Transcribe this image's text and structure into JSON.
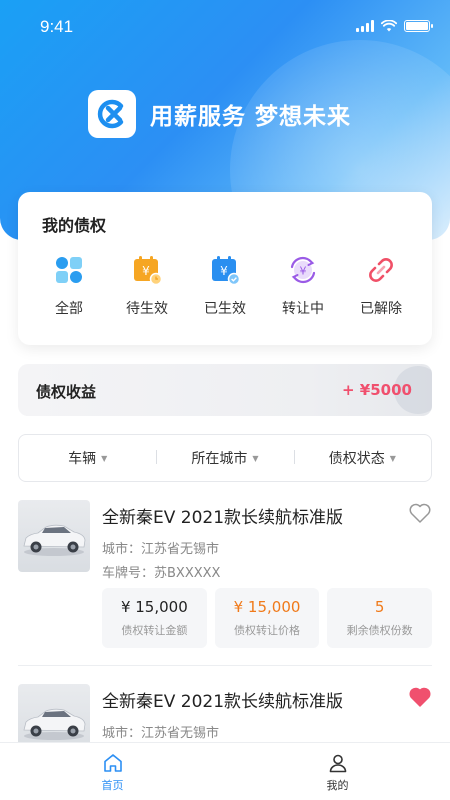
{
  "status_bar": {
    "time": "9:41"
  },
  "brand": {
    "slogan": "用薪服务 梦想未来",
    "logo_icon": "x-logo-icon"
  },
  "claims": {
    "title": "我的债权",
    "items": [
      {
        "label": "全部",
        "icon": "grid-icon",
        "color": "#2a9df0"
      },
      {
        "label": "待生效",
        "icon": "calendar-pending-icon",
        "color": "#f6a623"
      },
      {
        "label": "已生效",
        "icon": "calendar-check-icon",
        "color": "#2a8ff0"
      },
      {
        "label": "转让中",
        "icon": "transfer-yuan-icon",
        "color": "#9a5be6"
      },
      {
        "label": "已解除",
        "icon": "broken-link-icon",
        "color": "#f05067"
      }
    ]
  },
  "earnings": {
    "label": "债权收益",
    "value": "+ ¥5000",
    "color": "#f0506e"
  },
  "filters": [
    {
      "label": "车辆"
    },
    {
      "label": "所在城市"
    },
    {
      "label": "债权状态"
    }
  ],
  "listings": [
    {
      "title": "全新秦EV 2021款长续航标准版",
      "city": "城市：江苏省无锡市",
      "plate": "车牌号：苏BXXXXX",
      "favorited": false,
      "stats": [
        {
          "value": "¥ 15,000",
          "label": "债权转让金额"
        },
        {
          "value": "¥ 15,000",
          "label": "债权转让价格"
        },
        {
          "value": "5",
          "label": "剩余债权份数"
        }
      ]
    },
    {
      "title": "全新秦EV 2021款长续航标准版",
      "city": "城市：江苏省无锡市",
      "favorited": true
    }
  ],
  "tabs": [
    {
      "label": "首页",
      "icon": "home-icon",
      "active": true
    },
    {
      "label": "我的",
      "icon": "user-icon",
      "active": false
    }
  ],
  "colors": {
    "brand_blue": "#2c8ff4",
    "accent_orange": "#f07a1a",
    "heart_red": "#f0506e"
  }
}
